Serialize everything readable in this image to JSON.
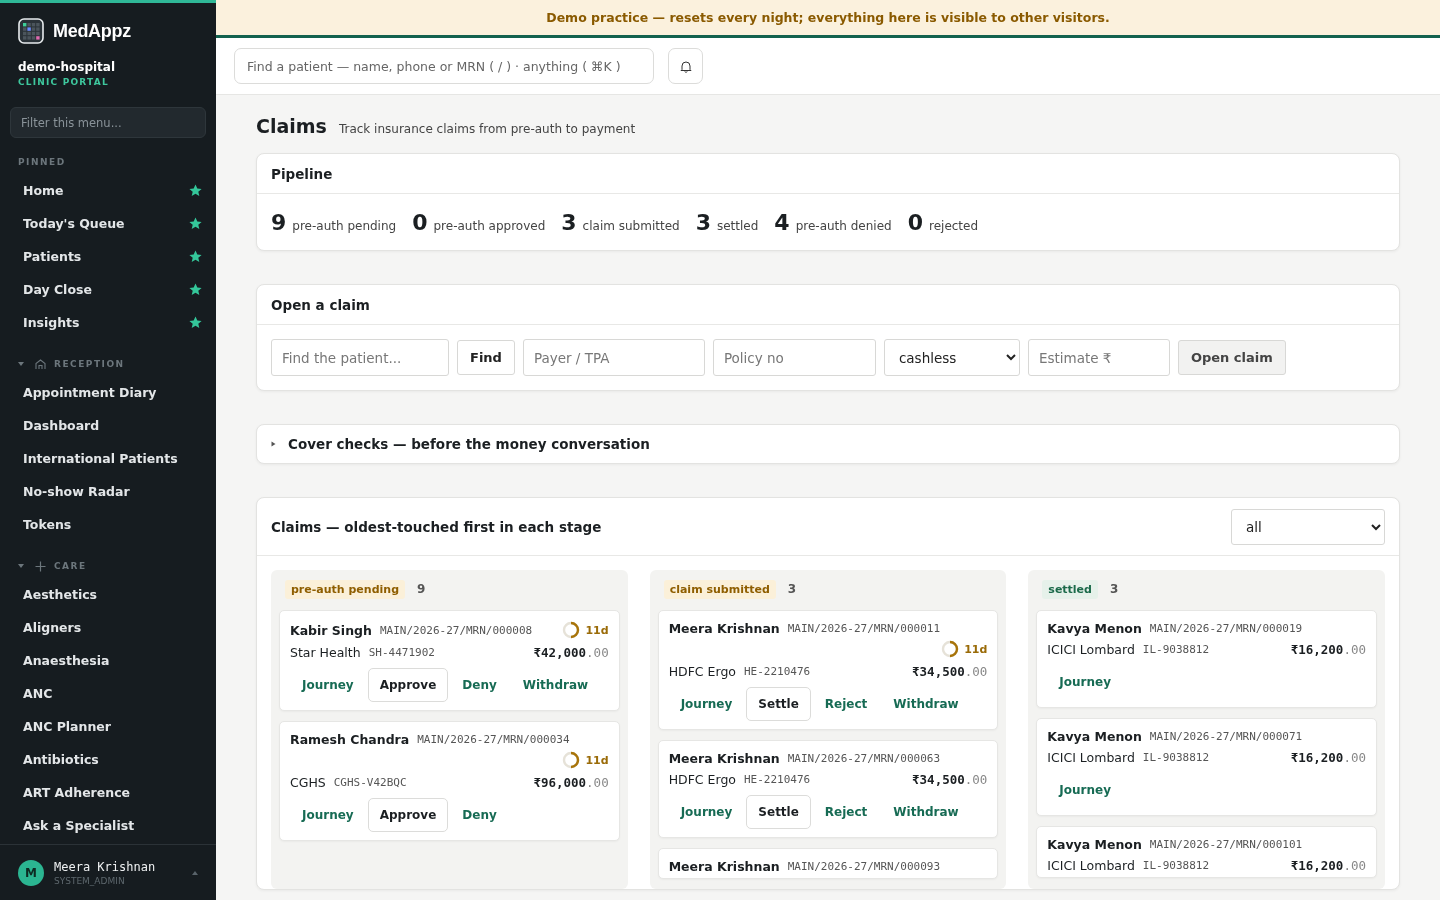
{
  "sidebar": {
    "brand": "MedAppz",
    "tenant": "demo-hospital",
    "portal": "CLINIC PORTAL",
    "filter": {
      "placeholder": "Filter this menu..."
    },
    "sections": [
      {
        "title": "PINNED",
        "collapsible": false,
        "items": [
          {
            "label": "Home",
            "starred": true
          },
          {
            "label": "Today's Queue",
            "starred": true
          },
          {
            "label": "Patients",
            "starred": true
          },
          {
            "label": "Day Close",
            "starred": true
          },
          {
            "label": "Insights",
            "starred": true
          }
        ]
      },
      {
        "title": "RECEPTION",
        "collapsible": true,
        "items": [
          {
            "label": "Appointment Diary",
            "starred": false
          },
          {
            "label": "Dashboard",
            "starred": false
          },
          {
            "label": "International Patients",
            "starred": false
          },
          {
            "label": "No-show Radar",
            "starred": false
          },
          {
            "label": "Tokens",
            "starred": false
          }
        ]
      },
      {
        "title": "CARE",
        "collapsible": true,
        "items": [
          {
            "label": "Aesthetics",
            "starred": false
          },
          {
            "label": "Aligners",
            "starred": false
          },
          {
            "label": "Anaesthesia",
            "starred": false
          },
          {
            "label": "ANC",
            "starred": false
          },
          {
            "label": "ANC Planner",
            "starred": false
          },
          {
            "label": "Antibiotics",
            "starred": false
          },
          {
            "label": "ART Adherence",
            "starred": false
          },
          {
            "label": "Ask a Specialist",
            "starred": false
          }
        ]
      }
    ],
    "user": {
      "initial": "M",
      "name": "Meera Krishnan",
      "role": "SYSTEM_ADMIN"
    }
  },
  "banner": "Demo practice — resets every night; everything here is visible to other visitors.",
  "search": {
    "placeholder": "Find a patient — name, phone or MRN ( / ) · anything ( ⌘K )"
  },
  "page": {
    "title": "Claims",
    "subtitle": "Track insurance claims from pre-auth to payment"
  },
  "pipeline": {
    "title": "Pipeline",
    "stats": [
      {
        "count": "9",
        "label": "pre-auth pending"
      },
      {
        "count": "0",
        "label": "pre-auth approved"
      },
      {
        "count": "3",
        "label": "claim submitted"
      },
      {
        "count": "3",
        "label": "settled"
      },
      {
        "count": "4",
        "label": "pre-auth denied"
      },
      {
        "count": "0",
        "label": "rejected"
      }
    ]
  },
  "open_claim": {
    "title": "Open a claim",
    "patient": {
      "placeholder": "Find the patient..."
    },
    "find_button": "Find",
    "payer": {
      "placeholder": "Payer / TPA"
    },
    "policy": {
      "placeholder": "Policy no"
    },
    "mode": "cashless",
    "estimate": {
      "placeholder": "Estimate ₹"
    },
    "submit_button": "Open claim"
  },
  "cover_checks": {
    "title": "Cover checks — before the money conversation",
    "expanded": false
  },
  "board": {
    "title": "Claims — oldest-touched first in each stage",
    "filter": "all",
    "columns": [
      {
        "stage": "pre-auth pending",
        "kind": "pending",
        "count": "9",
        "cards": [
          {
            "name": "Kabir Singh",
            "mrn": "MAIN/2026-27/MRN/000008",
            "age": "11d",
            "payer": "Star Health",
            "policy": "SH-4471902",
            "amount": "₹42,000",
            "decimals": ".00",
            "actions": [
              {
                "label": "Journey",
                "kind": "link"
              },
              {
                "label": "Approve",
                "kind": "button"
              },
              {
                "label": "Deny",
                "kind": "link"
              },
              {
                "label": "Withdraw",
                "kind": "link"
              }
            ]
          },
          {
            "name": "Ramesh Chandra",
            "mrn": "MAIN/2026-27/MRN/000034",
            "age": "11d",
            "payer": "CGHS",
            "policy": "CGHS-V42BQC",
            "amount": "₹96,000",
            "decimals": ".00",
            "actions": [
              {
                "label": "Journey",
                "kind": "link"
              },
              {
                "label": "Approve",
                "kind": "button"
              },
              {
                "label": "Deny",
                "kind": "link"
              }
            ]
          }
        ]
      },
      {
        "stage": "claim submitted",
        "kind": "pending",
        "count": "3",
        "cards": [
          {
            "name": "Meera Krishnan",
            "mrn": "MAIN/2026-27/MRN/000011",
            "age": "11d",
            "payer": "HDFC Ergo",
            "policy": "HE-2210476",
            "amount": "₹34,500",
            "decimals": ".00",
            "actions": [
              {
                "label": "Journey",
                "kind": "link"
              },
              {
                "label": "Settle",
                "kind": "button"
              },
              {
                "label": "Reject",
                "kind": "link"
              },
              {
                "label": "Withdraw",
                "kind": "link"
              }
            ]
          },
          {
            "name": "Meera Krishnan",
            "mrn": "MAIN/2026-27/MRN/000063",
            "payer": "HDFC Ergo",
            "policy": "HE-2210476",
            "amount": "₹34,500",
            "decimals": ".00",
            "actions": [
              {
                "label": "Journey",
                "kind": "link"
              },
              {
                "label": "Settle",
                "kind": "button"
              },
              {
                "label": "Reject",
                "kind": "link"
              },
              {
                "label": "Withdraw",
                "kind": "link"
              }
            ]
          },
          {
            "name": "Meera Krishnan",
            "mrn": "MAIN/2026-27/MRN/000093"
          }
        ]
      },
      {
        "stage": "settled",
        "kind": "done",
        "count": "3",
        "cards": [
          {
            "name": "Kavya Menon",
            "mrn": "MAIN/2026-27/MRN/000019",
            "payer": "ICICI Lombard",
            "policy": "IL-9038812",
            "amount": "₹16,200",
            "decimals": ".00",
            "actions": [
              {
                "label": "Journey",
                "kind": "link"
              }
            ]
          },
          {
            "name": "Kavya Menon",
            "mrn": "MAIN/2026-27/MRN/000071",
            "payer": "ICICI Lombard",
            "policy": "IL-9038812",
            "amount": "₹16,200",
            "decimals": ".00",
            "actions": [
              {
                "label": "Journey",
                "kind": "link"
              }
            ]
          },
          {
            "name": "Kavya Menon",
            "mrn": "MAIN/2026-27/MRN/000101",
            "payer": "ICICI Lombard",
            "policy": "IL-9038812",
            "amount": "₹16,200",
            "decimals": ".00"
          }
        ]
      }
    ]
  }
}
